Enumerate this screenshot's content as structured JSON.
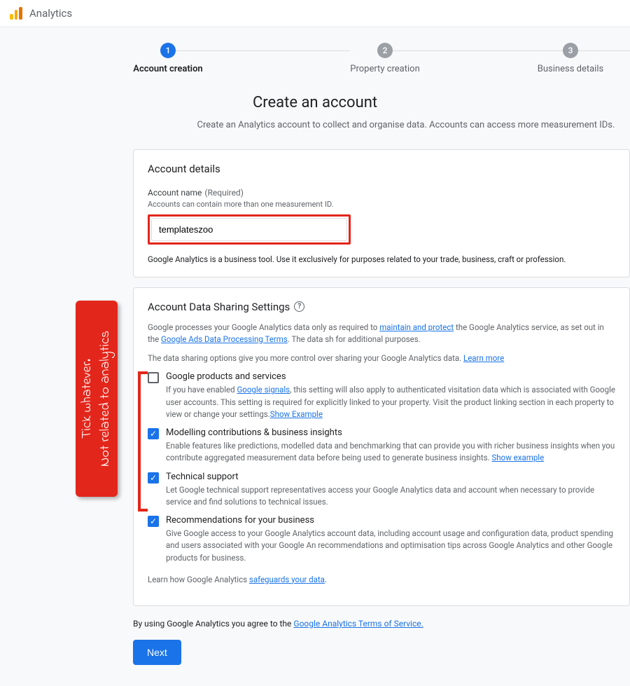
{
  "header": {
    "app_name": "Analytics"
  },
  "stepper": {
    "steps": [
      {
        "num": "1",
        "label": "Account creation"
      },
      {
        "num": "2",
        "label": "Property creation"
      },
      {
        "num": "3",
        "label": "Business details"
      }
    ]
  },
  "hero": {
    "title": "Create an account",
    "subtitle": "Create an Analytics account to collect and organise data. Accounts can access more measurement IDs."
  },
  "account_details": {
    "title": "Account details",
    "field_label": "Account name",
    "required": "(Required)",
    "sublabel": "Accounts can contain more than one measurement ID.",
    "value": "templateszoo",
    "disclaimer": "Google Analytics is a business tool. Use it exclusively for purposes related to your trade, business, craft or profession."
  },
  "sharing": {
    "title": "Account Data Sharing Settings",
    "intro_1a": "Google processes your Google Analytics data only as required to ",
    "intro_1_link1": "maintain and protect",
    "intro_1b": " the Google Analytics service, as set out in the ",
    "intro_1_link2": "Google Ads Data Processing Terms",
    "intro_1c": ". The data sh for additional purposes.",
    "intro_2a": "The data sharing options give you more control over sharing your Google Analytics data. ",
    "intro_2_link": "Learn more",
    "items": [
      {
        "checked": false,
        "title": "Google products and services",
        "desc_a": "If you have enabled ",
        "desc_link1": "Google signals",
        "desc_b": ", this setting will also apply to authenticated visitation data which is associated with Google user accounts. This setting is required for explicitly linked to your property. Visit the product linking section in each property to view or change your settings.",
        "desc_link2": "Show Example"
      },
      {
        "checked": true,
        "title": "Modelling contributions & business insights",
        "desc_a": "Enable features like predictions, modelled data and benchmarking that can provide you with richer business insights when you contribute aggregated measurement data before being used to generate business insights. ",
        "desc_link1": "Show example",
        "desc_b": "",
        "desc_link2": ""
      },
      {
        "checked": true,
        "title": "Technical support",
        "desc_a": "Let Google technical support representatives access your Google Analytics data and account when necessary to provide service and find solutions to technical issues.",
        "desc_link1": "",
        "desc_b": "",
        "desc_link2": ""
      },
      {
        "checked": true,
        "title": "Recommendations for your business",
        "desc_a": "Give Google access to your Google Analytics account data, including account usage and configuration data, product spending and users associated with your Google An recommendations and optimisation tips across Google Analytics and other Google products for business.",
        "desc_link1": "",
        "desc_b": "",
        "desc_link2": ""
      }
    ],
    "learn_a": "Learn how Google Analytics ",
    "learn_link": "safeguards your data",
    "learn_b": "."
  },
  "agree": {
    "prefix": "By using Google Analytics you agree to the ",
    "link": "Google Analytics Terms of Service."
  },
  "next": "Next",
  "callout": "Tick whatever.\nNot related to analytics"
}
